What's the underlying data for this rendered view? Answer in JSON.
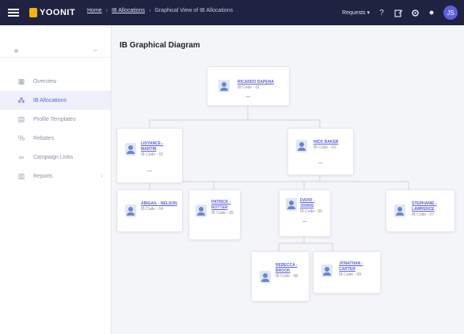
{
  "header": {
    "logo_text": "YOONIT",
    "breadcrumb": [
      "Home",
      "IB Allocations",
      "Graphical View of IB Allocations"
    ],
    "requests_label": "Requests",
    "help_glyph": "?",
    "user_initial": "JS"
  },
  "sidebar": {
    "items": [
      {
        "label": "Overview",
        "icon": "grid-icon"
      },
      {
        "label": "IB Allocations",
        "icon": "network-icon"
      },
      {
        "label": "Profile Templates",
        "icon": "template-icon"
      },
      {
        "label": "Rebates",
        "icon": "percent-icon"
      },
      {
        "label": "Campaign Links",
        "icon": "link-icon"
      },
      {
        "label": "Reports",
        "icon": "report-icon",
        "has_submenu": true
      }
    ],
    "active_index": 1
  },
  "main": {
    "title": "IB Graphical Diagram"
  },
  "tree": {
    "root": {
      "name": "RICARDO DAPENA",
      "meta": "IB Code - 01",
      "expand": "—"
    },
    "level1": [
      {
        "name": "LIDYANCE - MARTIN",
        "meta": "IB Code - 02",
        "expand": "—"
      },
      {
        "name": "NICK BAKER",
        "meta": "IB Code - 03",
        "expand": "—"
      }
    ],
    "level2": [
      {
        "name": "ABIGAIL - NELSON",
        "meta": "IB Code - 04"
      },
      {
        "name": "PATRICK - ROTTER",
        "meta": "IB Code - 05"
      },
      {
        "name": "DAVID - JOHNS",
        "meta": "IB Code - 06",
        "expand": "—"
      },
      {
        "name": "STEPHANIE - LAWRENCE",
        "meta": "IB Code - 07"
      }
    ],
    "level3": [
      {
        "name": "REBECCA - BROOK",
        "meta": "IB Code - 08"
      },
      {
        "name": "JONATHAN - CARTER",
        "meta": "IB Code - 09"
      }
    ]
  }
}
